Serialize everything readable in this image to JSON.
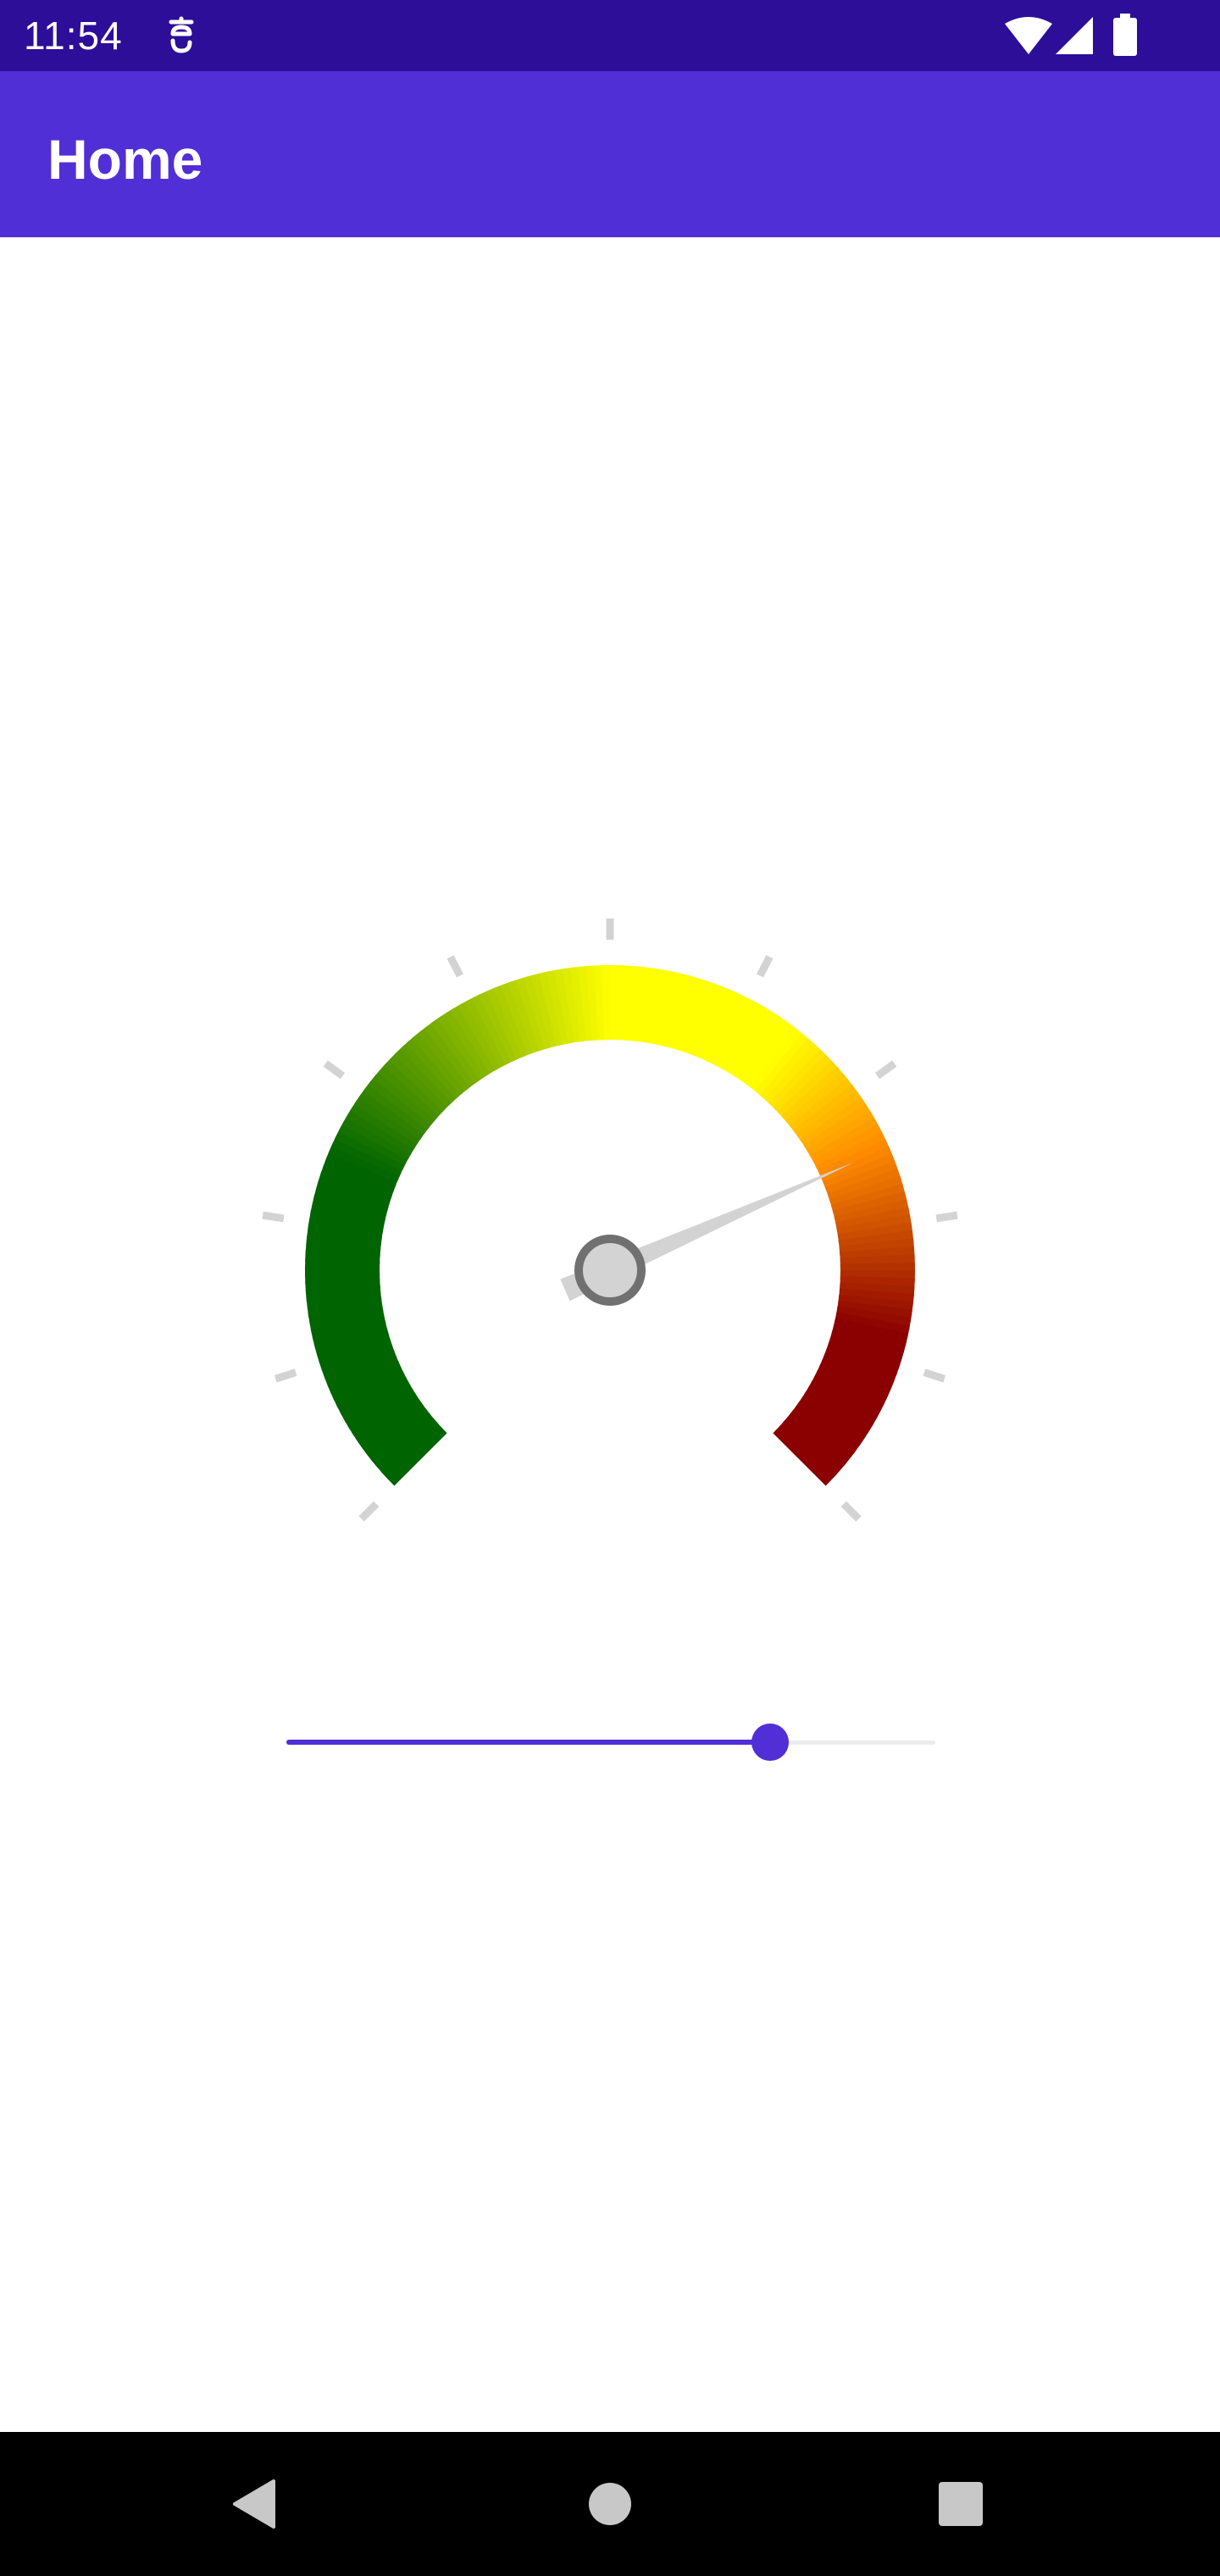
{
  "status_bar": {
    "time": "11:54",
    "background": "#2d0e99",
    "icons": [
      "notification-icon",
      "wifi-icon",
      "cell-signal-icon",
      "battery-icon"
    ]
  },
  "app_bar": {
    "title": "Home",
    "background": "#512fd6"
  },
  "gauge": {
    "value_fraction": 0.745,
    "colors": {
      "low": "#006400",
      "mid": "#ffff00",
      "high_mid": "#ff8c00",
      "high": "#8b0000",
      "needle": "#d3d3d3",
      "hub_ring": "#707070",
      "ticks": "#d3d3d3"
    },
    "tick_count": 11
  },
  "slider": {
    "value_fraction": 0.745,
    "accent": "#512fd6",
    "track_color": "#ececec"
  },
  "nav_bar": {
    "buttons": [
      "back-icon",
      "home-icon",
      "recents-icon"
    ]
  }
}
